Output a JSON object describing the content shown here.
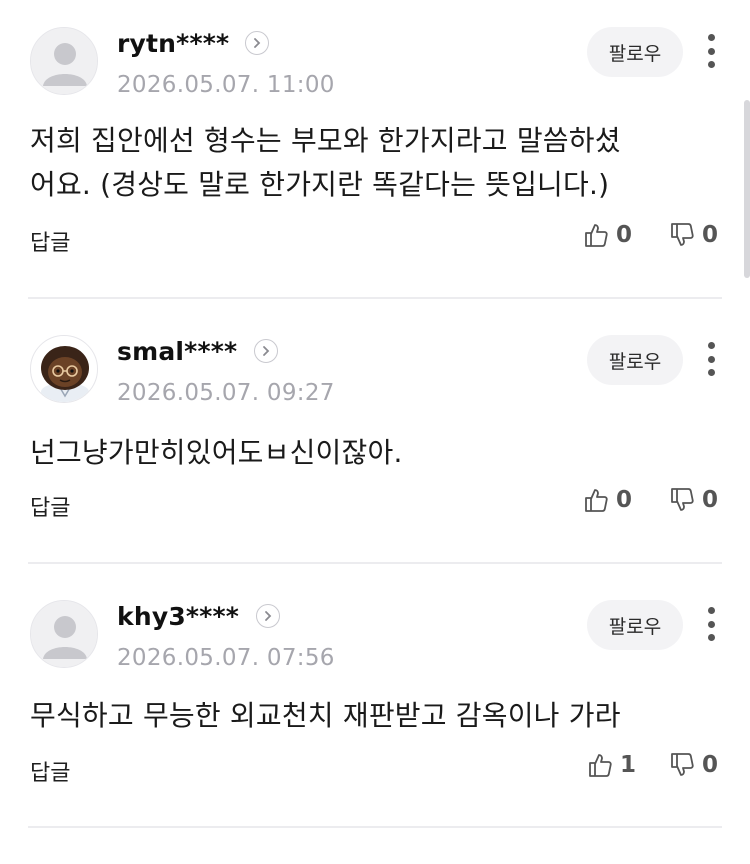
{
  "comments": [
    {
      "username": "rytn****",
      "timestamp": "2026.05.07. 11:00",
      "text_lines": [
        "저희 집안에선 형수는 부모와 한가지라고 말씀하셨",
        "어요. (경상도 말로 한가지란 똑같다는 뜻입니다.)"
      ],
      "follow_label": "팔로우",
      "reply_label": "답글",
      "likes": "0",
      "dislikes": "0",
      "avatar": "default-avatar"
    },
    {
      "username": "smal****",
      "timestamp": "2026.05.07. 09:27",
      "text_lines": [
        "넌그냥가만히있어도ㅂ신이잖아."
      ],
      "follow_label": "팔로우",
      "reply_label": "답글",
      "likes": "0",
      "dislikes": "0",
      "avatar": "character-avatar"
    },
    {
      "username": "khy3****",
      "timestamp": "2026.05.07. 07:56",
      "text_lines": [
        "무식하고 무능한 외교천치 재판받고 감옥이나 가라"
      ],
      "follow_label": "팔로우",
      "reply_label": "답글",
      "likes": "1",
      "dislikes": "0",
      "avatar": "default-avatar"
    }
  ],
  "colors": {
    "timestamp": "#a6a6ad",
    "follow_bg": "#f3f3f5",
    "divider": "#ececef"
  }
}
